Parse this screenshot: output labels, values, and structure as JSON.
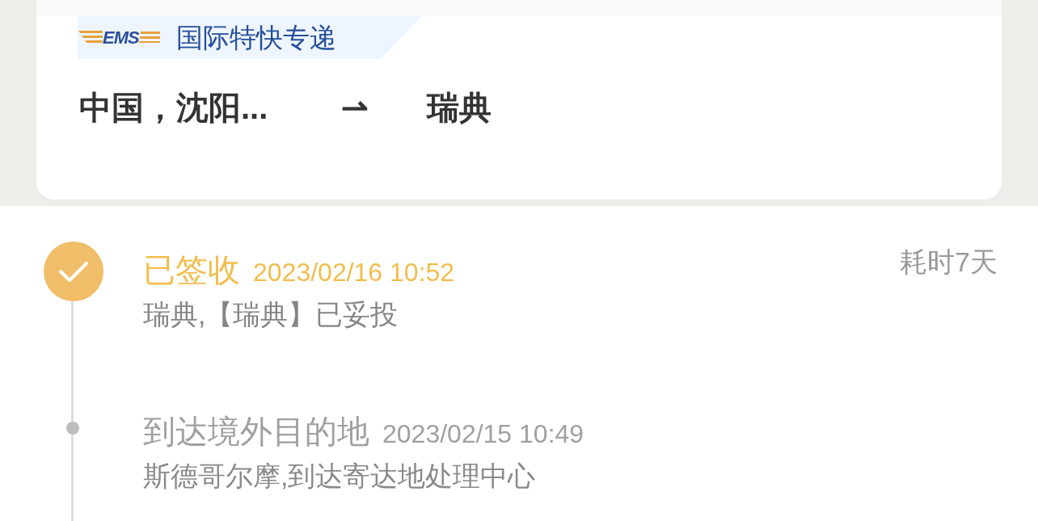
{
  "carrier": {
    "logo_text": "EMS",
    "service": "国际特快专递"
  },
  "route": {
    "origin": "中国，沈阳...",
    "arrow": "⇀",
    "destination": "瑞典"
  },
  "timeline": {
    "duration": "耗时7天",
    "events": [
      {
        "kind": "delivered",
        "current": true,
        "status": "已签收",
        "time": "2023/02/16 10:52",
        "detail": "瑞典,【瑞典】已妥投"
      },
      {
        "kind": "transit",
        "current": false,
        "status": "到达境外目的地",
        "time": "2023/02/15 10:49",
        "detail": "斯德哥尔摩,到达寄达地处理中心"
      }
    ]
  }
}
